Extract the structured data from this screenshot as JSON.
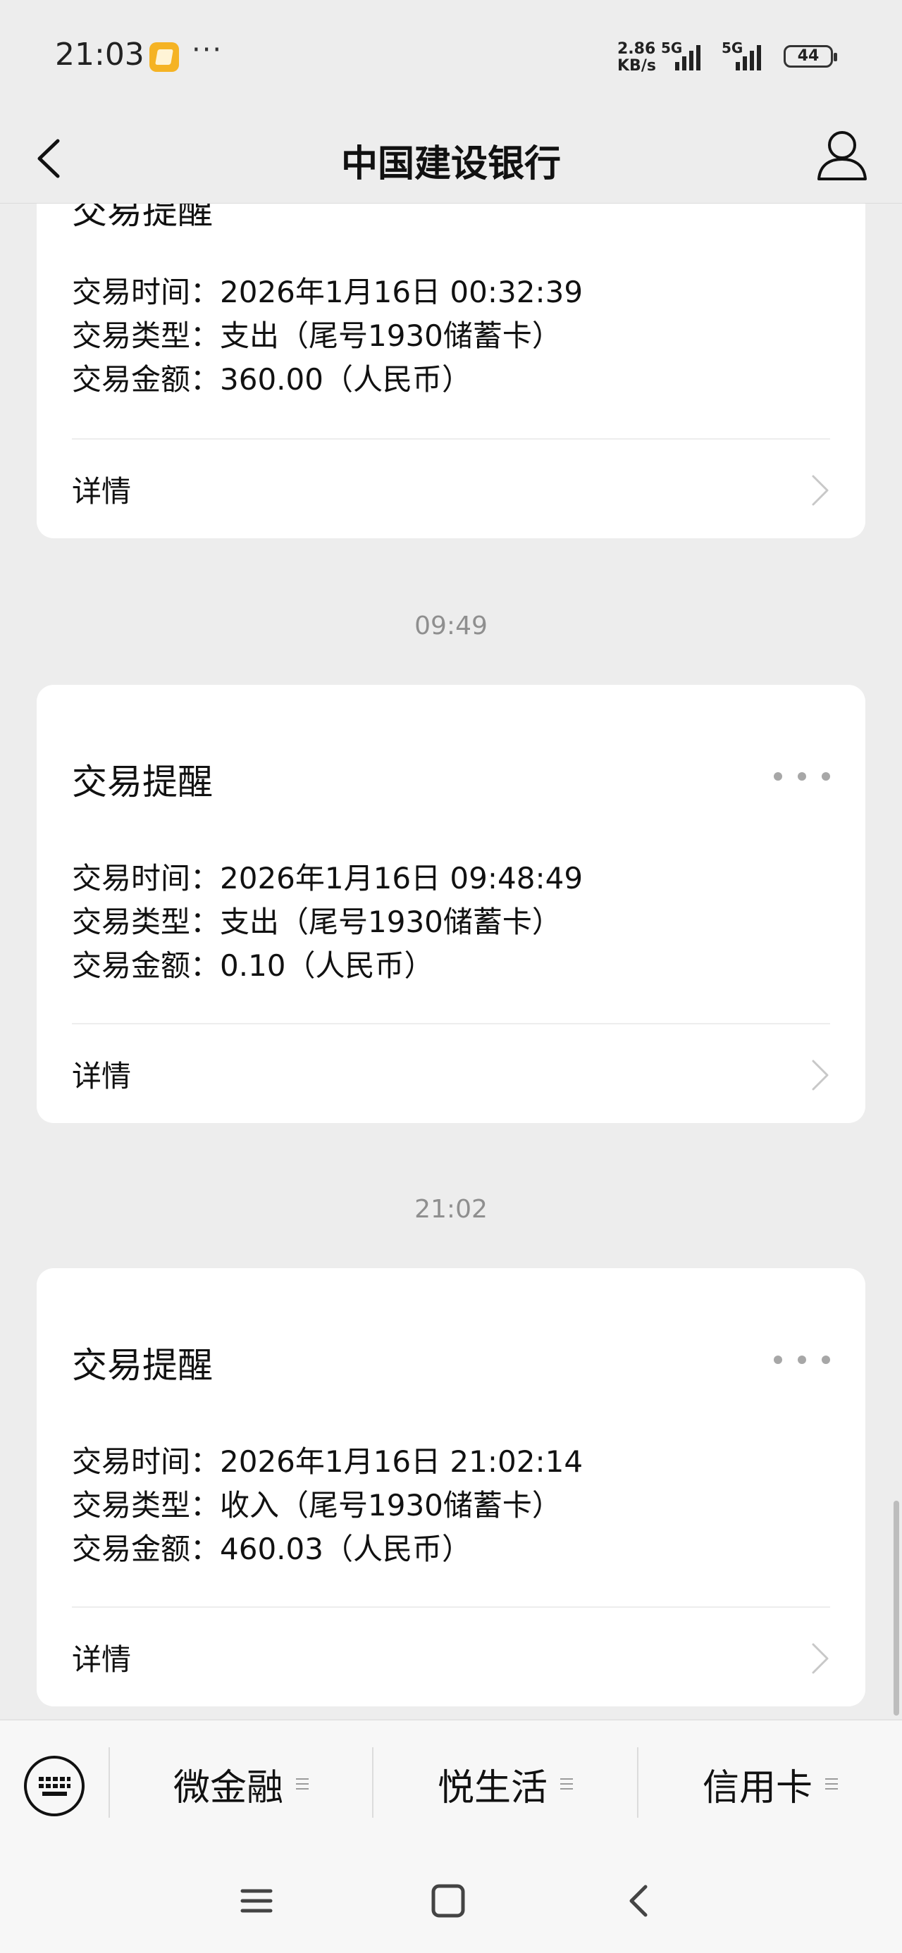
{
  "status_bar": {
    "time": "21:03",
    "speed_value": "2.86",
    "speed_unit": "KB/s",
    "net1": "5G",
    "net2": "5G",
    "battery": "44",
    "icons": [
      "app-notification-icon",
      "more-dots-icon",
      "signal-icon",
      "battery-icon"
    ]
  },
  "header": {
    "title": "中国建设银行",
    "icons": [
      "back-arrow-icon",
      "profile-icon"
    ]
  },
  "partial_card": {
    "title": "交易提醒",
    "rows": [
      {
        "label": "交易时间：",
        "value": "2026年1月16日 00:32:39"
      },
      {
        "label": "交易类型：",
        "value": "支出（尾号1930储蓄卡）"
      },
      {
        "label": "交易金额：",
        "value": "360.00（人民币）"
      }
    ],
    "detail": "详情"
  },
  "messages": [
    {
      "timestamp": "09:49",
      "title": "交易提醒",
      "rows": [
        {
          "label": "交易时间：",
          "value": "2026年1月16日 09:48:49"
        },
        {
          "label": "交易类型：",
          "value": "支出（尾号1930储蓄卡）"
        },
        {
          "label": "交易金额：",
          "value": "0.10（人民币）"
        }
      ],
      "detail": "详情"
    },
    {
      "timestamp": "21:02",
      "title": "交易提醒",
      "rows": [
        {
          "label": "交易时间：",
          "value": "2026年1月16日 21:02:14"
        },
        {
          "label": "交易类型：",
          "value": "收入（尾号1930储蓄卡）"
        },
        {
          "label": "交易金额：",
          "value": "460.03（人民币）"
        }
      ],
      "detail": "详情"
    }
  ],
  "bottom_menu": {
    "items": [
      {
        "label": "微金融"
      },
      {
        "label": "悦生活"
      },
      {
        "label": "信用卡"
      }
    ],
    "icons": [
      "keyboard-icon",
      "menu-lines-icon"
    ]
  },
  "nav_bar": {
    "icons": [
      "menu-icon",
      "home-square-icon",
      "back-triangle-icon"
    ]
  }
}
